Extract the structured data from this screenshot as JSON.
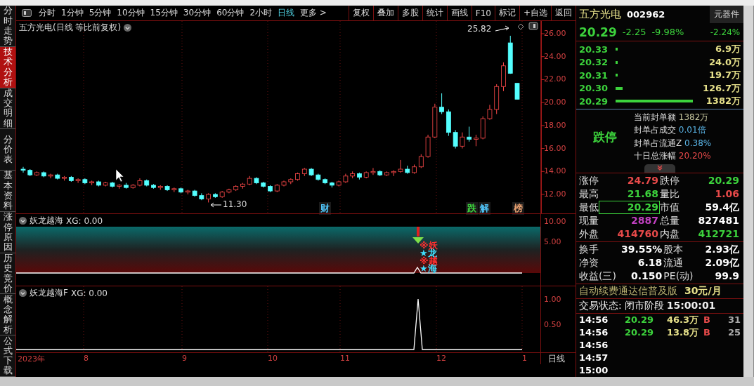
{
  "side_tabs": [
    {
      "label": "分时走势",
      "selected": false
    },
    {
      "label": "技术分析",
      "selected": true
    },
    {
      "label": "成交明细",
      "selected": false
    },
    {
      "label": "分价表",
      "selected": false
    },
    {
      "label": "基本资料",
      "selected": false
    },
    {
      "label": "涨停原因",
      "selected": false
    },
    {
      "label": "历史竞价",
      "selected": false
    },
    {
      "label": "概念解析",
      "selected": false
    },
    {
      "label": "公式下载",
      "selected": false
    }
  ],
  "periods": [
    {
      "label": "分时",
      "selected": false
    },
    {
      "label": "1分钟",
      "selected": false
    },
    {
      "label": "5分钟",
      "selected": false
    },
    {
      "label": "10分钟",
      "selected": false
    },
    {
      "label": "15分钟",
      "selected": false
    },
    {
      "label": "30分钟",
      "selected": false
    },
    {
      "label": "60分钟",
      "selected": false
    },
    {
      "label": "2小时",
      "selected": false
    },
    {
      "label": "日线",
      "selected": true
    },
    {
      "label": "更多 >",
      "selected": false
    }
  ],
  "toolbar_buttons": [
    "复权",
    "叠加",
    "多股",
    "统计",
    "画线",
    "F10",
    "标记",
    "+自选",
    "返回"
  ],
  "main_chart": {
    "title": "五方光电(日线 等比前复权)",
    "high_label": "25.82",
    "low_label": "11.30",
    "chart_data": {
      "type": "candlestick",
      "grid": true,
      "ylim": [
        10.35,
        27.1
      ],
      "yticks": [
        {
          "value": 26,
          "label": "26.00"
        },
        {
          "value": 24,
          "label": "24.00"
        },
        {
          "value": 22,
          "label": "22.00"
        },
        {
          "value": 20,
          "label": "20.00"
        },
        {
          "value": 18,
          "label": "18.00"
        },
        {
          "value": 16,
          "label": "16.00"
        },
        {
          "value": 14,
          "label": "14.00"
        },
        {
          "value": 12,
          "label": "12.00"
        }
      ],
      "ohlc": [
        [
          14.2,
          14.4,
          13.9,
          14.1
        ],
        [
          14.1,
          14.2,
          13.6,
          13.7
        ],
        [
          13.7,
          14.0,
          13.6,
          13.9
        ],
        [
          13.9,
          14.0,
          13.5,
          13.6
        ],
        [
          13.6,
          13.8,
          13.4,
          13.7
        ],
        [
          13.7,
          13.8,
          13.3,
          13.4
        ],
        [
          13.4,
          13.6,
          13.2,
          13.5
        ],
        [
          13.5,
          13.6,
          13.1,
          13.2
        ],
        [
          13.2,
          13.4,
          13.0,
          13.3
        ],
        [
          13.3,
          13.4,
          12.9,
          13.0
        ],
        [
          13.0,
          13.2,
          12.8,
          13.1
        ],
        [
          13.1,
          13.2,
          12.7,
          12.8
        ],
        [
          12.8,
          13.1,
          12.7,
          13.0
        ],
        [
          13.0,
          13.1,
          12.6,
          12.7
        ],
        [
          12.7,
          12.9,
          12.5,
          12.8
        ],
        [
          12.8,
          13.0,
          12.5,
          12.6
        ],
        [
          12.6,
          12.9,
          12.5,
          12.8
        ],
        [
          12.8,
          13.4,
          12.7,
          13.2
        ],
        [
          13.2,
          13.3,
          12.7,
          12.8
        ],
        [
          12.8,
          12.9,
          12.5,
          12.6
        ],
        [
          12.6,
          12.8,
          12.4,
          12.7
        ],
        [
          12.7,
          12.8,
          12.3,
          12.4
        ],
        [
          12.4,
          12.6,
          12.2,
          12.5
        ],
        [
          12.5,
          12.6,
          12.1,
          12.2
        ],
        [
          12.2,
          12.4,
          12.0,
          12.3
        ],
        [
          12.3,
          12.4,
          11.8,
          11.9
        ],
        [
          11.9,
          12.1,
          11.5,
          11.6
        ],
        [
          11.6,
          12.1,
          11.3,
          12.0
        ],
        [
          12.0,
          12.1,
          11.7,
          11.8
        ],
        [
          11.8,
          12.3,
          11.7,
          12.2
        ],
        [
          12.2,
          12.5,
          12.1,
          12.4
        ],
        [
          12.4,
          12.8,
          12.3,
          12.7
        ],
        [
          12.7,
          13.0,
          12.5,
          12.9
        ],
        [
          12.9,
          13.6,
          12.8,
          13.4
        ],
        [
          13.4,
          13.5,
          12.9,
          13.0
        ],
        [
          13.0,
          13.1,
          12.6,
          12.7
        ],
        [
          12.7,
          12.8,
          12.2,
          12.3
        ],
        [
          12.3,
          12.9,
          12.2,
          12.8
        ],
        [
          12.8,
          13.2,
          12.7,
          13.1
        ],
        [
          13.1,
          13.4,
          12.9,
          13.3
        ],
        [
          13.3,
          13.9,
          13.2,
          13.8
        ],
        [
          13.8,
          14.3,
          13.6,
          14.2
        ],
        [
          14.2,
          14.3,
          13.6,
          13.7
        ],
        [
          13.7,
          13.8,
          13.2,
          13.3
        ],
        [
          13.3,
          13.4,
          12.9,
          13.0
        ],
        [
          13.0,
          13.1,
          12.6,
          12.8
        ],
        [
          12.8,
          13.2,
          12.7,
          13.1
        ],
        [
          13.1,
          13.8,
          13.0,
          13.6
        ],
        [
          13.6,
          14.0,
          13.4,
          13.8
        ],
        [
          13.8,
          13.9,
          13.3,
          13.5
        ],
        [
          13.5,
          14.0,
          13.4,
          13.9
        ],
        [
          13.9,
          14.3,
          13.7,
          14.0
        ],
        [
          14.0,
          14.1,
          13.6,
          13.7
        ],
        [
          13.7,
          14.0,
          13.6,
          13.9
        ],
        [
          13.9,
          14.1,
          13.6,
          14.0
        ],
        [
          14.0,
          15.0,
          13.9,
          14.2
        ],
        [
          14.2,
          14.5,
          13.8,
          13.9
        ],
        [
          13.9,
          14.6,
          13.8,
          14.4
        ],
        [
          14.4,
          15.5,
          14.3,
          15.3
        ],
        [
          15.3,
          17.2,
          15.2,
          17.0
        ],
        [
          17.0,
          19.9,
          16.9,
          19.6
        ],
        [
          19.6,
          20.8,
          19.0,
          19.2
        ],
        [
          19.2,
          19.4,
          17.1,
          17.4
        ],
        [
          17.4,
          17.6,
          16.0,
          16.2
        ],
        [
          16.2,
          17.4,
          16.0,
          17.0
        ],
        [
          17.0,
          17.9,
          16.6,
          16.8
        ],
        [
          16.8,
          17.2,
          16.2,
          16.9
        ],
        [
          16.9,
          18.8,
          16.8,
          18.6
        ],
        [
          18.6,
          19.8,
          18.5,
          19.4
        ],
        [
          19.4,
          21.6,
          19.0,
          21.4
        ],
        [
          21.4,
          23.5,
          21.0,
          23.2
        ],
        [
          25.2,
          25.82,
          22.5,
          22.54
        ],
        [
          21.68,
          21.68,
          20.29,
          20.29
        ]
      ]
    },
    "event_tags": [
      {
        "label": "财",
        "color": "#4fc3f7"
      },
      {
        "label": "跌",
        "color": "#3cd23c"
      },
      {
        "label": "解",
        "color": "#4fc3f7"
      },
      {
        "label": "榜",
        "color": "#e8a070"
      }
    ]
  },
  "indicator_1": {
    "name": "妖龙越海",
    "value": "XG: 0.00",
    "yticks": [
      "10.00",
      "5.00"
    ],
    "signals": [
      {
        "text": "※妖",
        "color": "#ff3030"
      },
      {
        "text": "★龙",
        "color": "#40e0ff"
      },
      {
        "text": "※越",
        "color": "#ff3030"
      },
      {
        "text": "★海",
        "color": "#40e0ff"
      }
    ]
  },
  "indicator_2": {
    "name": "妖龙越海F",
    "value": "XG: 0.00",
    "yticks": [
      "1.00",
      "0.50"
    ]
  },
  "x_axis": {
    "labels": [
      "2023年",
      "8",
      "9",
      "10",
      "11",
      "12",
      "1"
    ],
    "period": "日线"
  },
  "quote": {
    "name": "五方光电",
    "code": "002962",
    "sector": "元器件",
    "sector_change": "-2.24%",
    "price": "20.29",
    "change": "-2.25",
    "change_pct": "-9.98%"
  },
  "order_book": [
    {
      "price": "20.33",
      "volume": "6.9万"
    },
    {
      "price": "20.32",
      "volume": "24.0万"
    },
    {
      "price": "20.31",
      "volume": "19.7万"
    },
    {
      "price": "20.30",
      "volume": "126.7万"
    },
    {
      "price": "20.29",
      "volume": "1382万"
    }
  ],
  "seal": {
    "status": "跌停",
    "lines": [
      {
        "label": "当前封单额",
        "value": "1382万",
        "color": "#c8c8a0"
      },
      {
        "label": "封单占成交",
        "value": "0.01倍",
        "color": "#5ab4e6"
      },
      {
        "label": "封单占流通Z",
        "value": "0.38%",
        "color": "#5ab4e6"
      },
      {
        "label": "十日总涨幅",
        "value": "20.20%",
        "color": "#e84a4a"
      }
    ]
  },
  "stats": [
    {
      "label": "涨停",
      "value": "24.79",
      "color": "#e84a4a",
      "highlighted": false
    },
    {
      "label": "跌停",
      "value": "20.29",
      "color": "#3cd23c",
      "highlighted": false
    },
    {
      "label": "最高",
      "value": "21.68",
      "color": "#3cd23c",
      "highlighted": false
    },
    {
      "label": "量比",
      "value": "1.06",
      "color": "#e84a4a",
      "highlighted": false
    },
    {
      "label": "最低",
      "value": "20.29",
      "color": "#3cd23c",
      "highlighted": true
    },
    {
      "label": "市值",
      "value": "59.4亿",
      "color": "#ffffff",
      "highlighted": false
    },
    {
      "label": "现量",
      "value": "2887",
      "color": "#c040c0",
      "highlighted": false
    },
    {
      "label": "总量",
      "value": "827481",
      "color": "#ffffff",
      "highlighted": false
    },
    {
      "label": "外盘",
      "value": "414760",
      "color": "#e84a4a",
      "highlighted": false
    },
    {
      "label": "内盘",
      "value": "412721",
      "color": "#3cd23c",
      "highlighted": false
    }
  ],
  "fundamentals": [
    {
      "label": "换手",
      "value": "39.55%"
    },
    {
      "label": "股本",
      "value": "2.93亿"
    },
    {
      "label": "净资",
      "value": "6.18"
    },
    {
      "label": "流通",
      "value": "2.09亿"
    },
    {
      "label": "收益(三)",
      "value": "0.150"
    },
    {
      "label": "PE(动)",
      "value": "99.9"
    }
  ],
  "promo": {
    "text": "自动续费通达信普及版",
    "price": "30元/月"
  },
  "trade_status": {
    "label": "交易状态:",
    "phase": "闭市阶段",
    "time": "15:00:01"
  },
  "ticks": [
    {
      "time": "14:56",
      "price": "20.29",
      "volume": "46.3万",
      "side": "B",
      "count": "31"
    },
    {
      "time": "14:56",
      "price": "20.29",
      "volume": "13.8万",
      "side": "B",
      "count": "25"
    },
    {
      "time": "14:56"
    },
    {
      "time": "14:57"
    },
    {
      "time": "15:00"
    }
  ]
}
